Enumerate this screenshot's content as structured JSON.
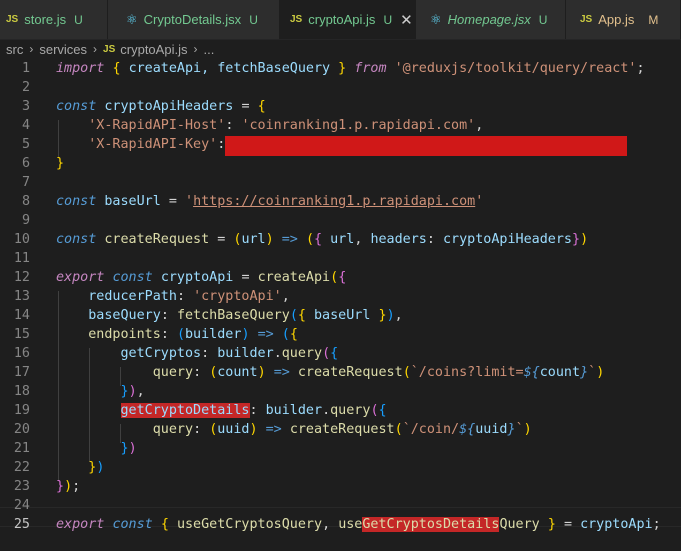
{
  "tabs": [
    {
      "label": "store.js",
      "status": "U",
      "type": "js",
      "italic": false
    },
    {
      "label": "CryptoDetails.jsx",
      "status": "U",
      "type": "react",
      "italic": false
    },
    {
      "label": "cryptoApi.js",
      "status": "U",
      "type": "js",
      "active": true
    },
    {
      "label": "Homepage.jsx",
      "status": "U",
      "type": "react",
      "italic": true
    },
    {
      "label": "App.js",
      "status": "M",
      "type": "js"
    }
  ],
  "icons": {
    "js": "JS",
    "react": "⚛",
    "close": "✕",
    "chevron": "›"
  },
  "breadcrumb": {
    "items": [
      "src",
      "services",
      "cryptoApi.js",
      "..."
    ]
  },
  "line_numbers": [
    "1",
    "2",
    "3",
    "4",
    "5",
    "6",
    "7",
    "8",
    "9",
    "10",
    "11",
    "12",
    "13",
    "14",
    "15",
    "16",
    "17",
    "18",
    "19",
    "20",
    "21",
    "22",
    "23",
    "24",
    "25"
  ],
  "code": {
    "l1": {
      "import": "import",
      "names": "createApi, fetchBaseQuery",
      "from": "from",
      "module": "'@reduxjs/toolkit/query/react'"
    },
    "l3": {
      "const": "const",
      "name": "cryptoApiHeaders"
    },
    "l4": {
      "key": "'X-RapidAPI-Host'",
      "value": "'coinranking1.p.rapidapi.com'"
    },
    "l5": {
      "key": "'X-RapidAPI-Key'"
    },
    "l8": {
      "const": "const",
      "name": "baseUrl",
      "quote_open": "'",
      "url": "https://coinranking1.p.rapidapi.com",
      "quote_close": "'"
    },
    "l10": {
      "const": "const",
      "name": "createRequest",
      "param": "url",
      "arrow": "=>",
      "p1": "url",
      "p2": "headers",
      "p3": "cryptoApiHeaders"
    },
    "l12": {
      "export": "export",
      "const": "const",
      "name": "cryptoApi",
      "fn": "createApi"
    },
    "l13": {
      "prop": "reducerPath",
      "value": "'cryptoApi'"
    },
    "l14": {
      "prop": "baseQuery",
      "fn": "fetchBaseQuery",
      "arg": "baseUrl"
    },
    "l15": {
      "prop": "endpoints",
      "param": "builder",
      "arrow": "=>"
    },
    "l16": {
      "prop": "getCryptos",
      "obj": "builder",
      "method": "query"
    },
    "l17": {
      "prop": "query",
      "param": "count",
      "arrow": "=>",
      "fn": "createRequest",
      "tpl1": "`/coins?limit=",
      "dollar": "${",
      "var": "count",
      "close": "}",
      "tpl2": "`"
    },
    "l19": {
      "prop": "getCryptoDetails",
      "obj": "builder",
      "method": "query"
    },
    "l20": {
      "prop": "query",
      "param": "uuid",
      "arrow": "=>",
      "fn": "createRequest",
      "tpl1": "`/coin/",
      "dollar": "${",
      "var": "uuid",
      "close": "}",
      "tpl2": "`"
    },
    "l25": {
      "export": "export",
      "const": "const",
      "h1": "useGetCryptosQuery",
      "h2a": "use",
      "h2b": "GetCryptosDetails",
      "h2c": "Query",
      "rhs": "cryptoApi"
    }
  },
  "colors": {
    "background": "#1e1e1e",
    "tabbar": "#252526",
    "redaction": "#d01818",
    "highlight": "#c42727",
    "keyword": "#569cd6",
    "function": "#dcdcaa",
    "string": "#ce9178",
    "variable": "#9cdcfe"
  }
}
